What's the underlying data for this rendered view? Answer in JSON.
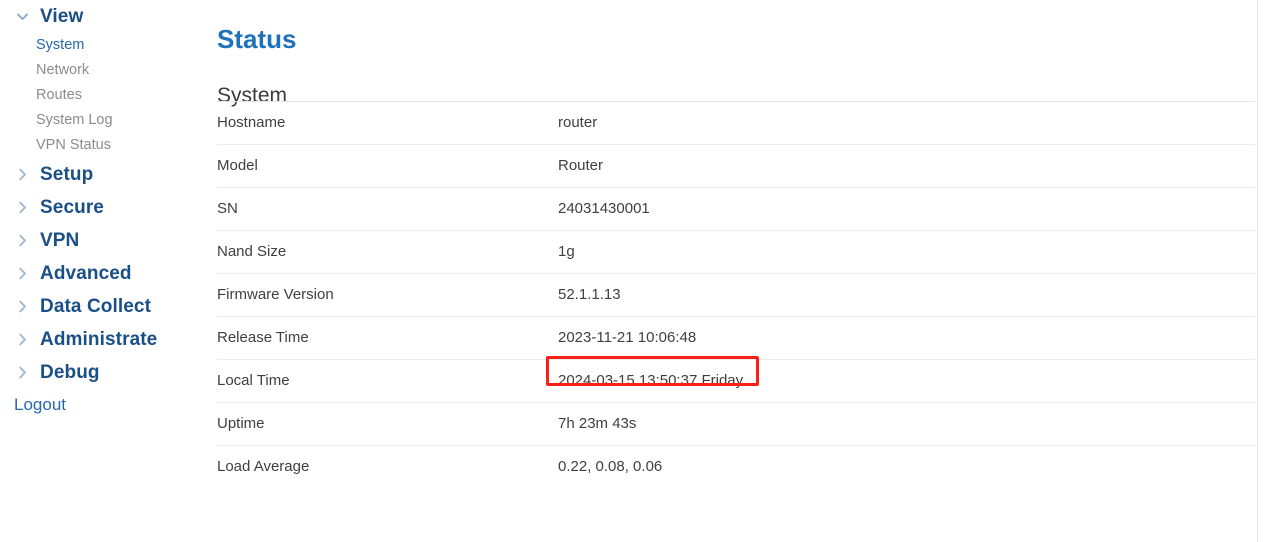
{
  "sidebar": {
    "groups": [
      {
        "label": "View",
        "icon": "chevron-down-icon",
        "expanded": true,
        "items": [
          {
            "label": "System",
            "active": true
          },
          {
            "label": "Network",
            "active": false
          },
          {
            "label": "Routes",
            "active": false
          },
          {
            "label": "System Log",
            "active": false
          },
          {
            "label": "VPN Status",
            "active": false
          }
        ]
      },
      {
        "label": "Setup",
        "icon": "chevron-right-icon",
        "expanded": false,
        "items": []
      },
      {
        "label": "Secure",
        "icon": "chevron-right-icon",
        "expanded": false,
        "items": []
      },
      {
        "label": "VPN",
        "icon": "chevron-right-icon",
        "expanded": false,
        "items": []
      },
      {
        "label": "Advanced",
        "icon": "chevron-right-icon",
        "expanded": false,
        "items": []
      },
      {
        "label": "Data Collect",
        "icon": "chevron-right-icon",
        "expanded": false,
        "items": []
      },
      {
        "label": "Administrate",
        "icon": "chevron-right-icon",
        "expanded": false,
        "items": []
      },
      {
        "label": "Debug",
        "icon": "chevron-right-icon",
        "expanded": false,
        "items": []
      }
    ],
    "logout_label": "Logout"
  },
  "main": {
    "page_title": "Status",
    "section_title": "System",
    "rows": [
      {
        "label": "Hostname",
        "value": "router",
        "highlight": false
      },
      {
        "label": "Model",
        "value": "Router",
        "highlight": false
      },
      {
        "label": "SN",
        "value": "24031430001",
        "highlight": false
      },
      {
        "label": "Nand Size",
        "value": "1g",
        "highlight": false
      },
      {
        "label": "Firmware Version",
        "value": "52.1.1.13",
        "highlight": false
      },
      {
        "label": "Release Time",
        "value": "2023-11-21 10:06:48",
        "highlight": false
      },
      {
        "label": "Local Time",
        "value": "2024-03-15 13:50:37 Friday",
        "highlight": true
      },
      {
        "label": "Uptime",
        "value": "7h 23m 43s",
        "highlight": false
      },
      {
        "label": "Load Average",
        "value": "0.22, 0.08, 0.06",
        "highlight": false
      }
    ]
  },
  "colors": {
    "page_title": "#2072b8",
    "nav_group": "#1a4f87",
    "nav_active": "#2767ab",
    "nav_inactive": "#8c8c8c",
    "chevron": "#9fb6cf",
    "chevron_active": "#8aa6c4",
    "highlight_border": "#fb2015",
    "row_divider": "#eceded",
    "text": "#3f3f3f"
  }
}
